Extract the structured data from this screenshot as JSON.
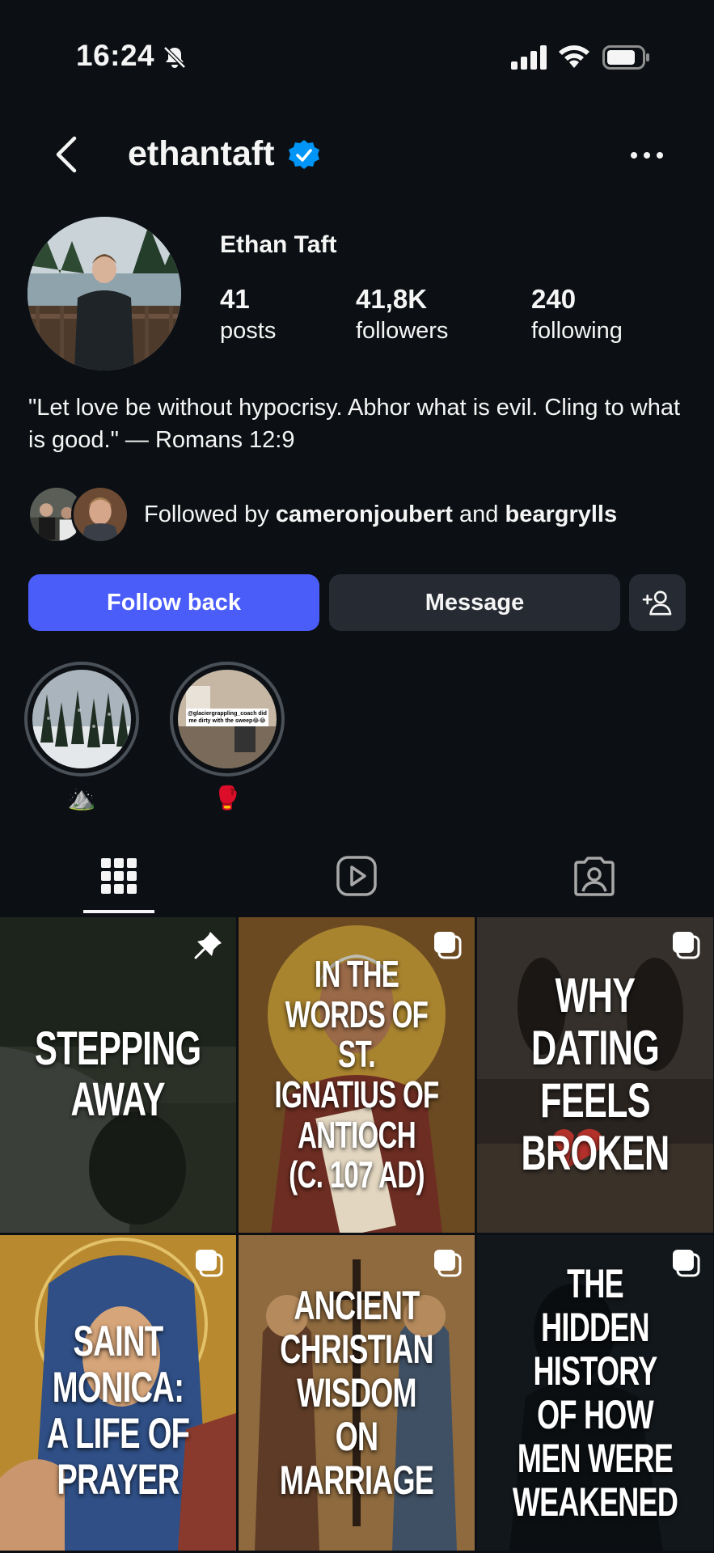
{
  "status_bar": {
    "time": "16:24"
  },
  "header": {
    "username": "ethantaft"
  },
  "profile": {
    "display_name": "Ethan Taft",
    "stats": [
      {
        "value": "41",
        "label": "posts"
      },
      {
        "value": "41,8K",
        "label": "followers"
      },
      {
        "value": "240",
        "label": "following"
      }
    ],
    "bio": "\"Let love be without hypocrisy. Abhor what is evil. Cling to what is good.\" — Romans 12:9",
    "followed_by": {
      "prefix": "Followed by ",
      "user1": "cameronjoubert",
      "joiner": " and ",
      "user2": "beargrylls"
    }
  },
  "actions": {
    "follow_label": "Follow back",
    "message_label": "Message"
  },
  "highlights": [
    {
      "label": "⛰️",
      "icon": "mountain-emoji"
    },
    {
      "label": "🥊",
      "icon": "boxing-glove-emoji",
      "caption": "@glaciergrappling_coach did me dirty with the sweep😂😂"
    }
  ],
  "tabs": [
    {
      "name": "posts-grid",
      "icon": "grid-icon",
      "active": true
    },
    {
      "name": "reels",
      "icon": "reels-icon",
      "active": false
    },
    {
      "name": "tagged",
      "icon": "tagged-icon",
      "active": false
    }
  ],
  "posts": [
    {
      "title": "STEPPING\nAWAY",
      "badge": "pin-icon"
    },
    {
      "title": "IN THE WORDS OF ST.\nIGNATIUS OF ANTIOCH\n(C. 107 AD)",
      "badge": "carousel-icon"
    },
    {
      "title": "WHY DATING\nFEELS BROKEN",
      "badge": "carousel-icon"
    },
    {
      "title": "SAINT MONICA:\nA LIFE OF PRAYER",
      "badge": "carousel-icon"
    },
    {
      "title": "ANCIENT\nCHRISTIAN WISDOM\nON MARRIAGE",
      "badge": "carousel-icon"
    },
    {
      "title": "THE HIDDEN HISTORY\nOF HOW MEN WERE\nWEAKENED",
      "badge": "carousel-icon"
    }
  ],
  "colors": {
    "background": "#0c1014",
    "primary_button": "#4a5df9",
    "secondary_button": "#262b33",
    "verified": "#0095f6"
  }
}
